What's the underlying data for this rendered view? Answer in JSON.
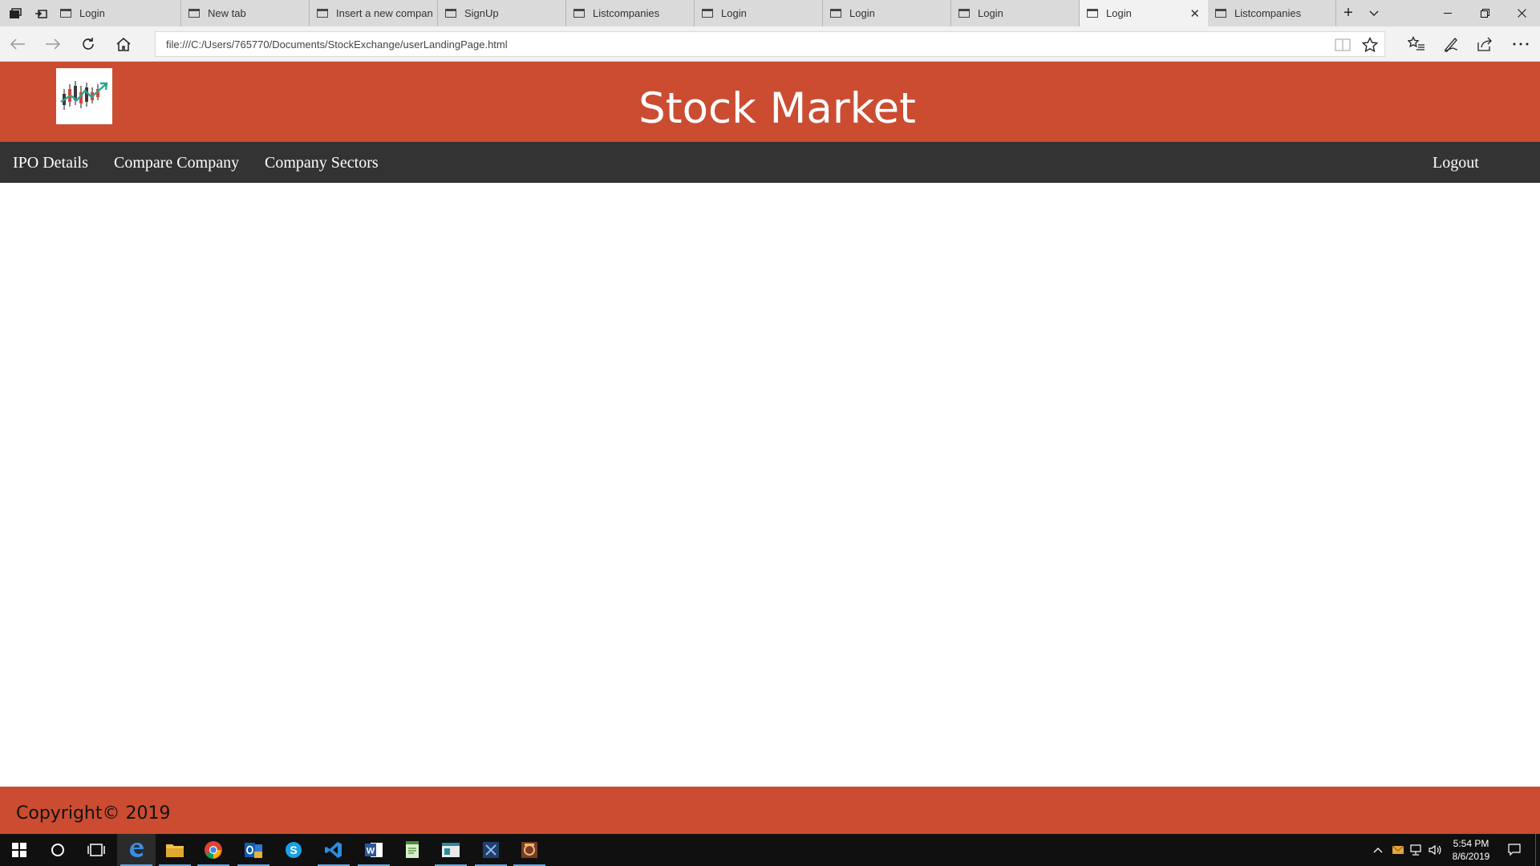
{
  "browser": {
    "tabs": [
      {
        "label": "Login"
      },
      {
        "label": "New tab"
      },
      {
        "label": "Insert a new compan"
      },
      {
        "label": "SignUp"
      },
      {
        "label": "Listcompanies"
      },
      {
        "label": "Login"
      },
      {
        "label": "Login"
      },
      {
        "label": "Login"
      },
      {
        "label": "Login",
        "active": true
      },
      {
        "label": "Listcompanies"
      }
    ],
    "url": "file:///C:/Users/765770/Documents/StockExchange/userLandingPage.html"
  },
  "page": {
    "title": "Stock Market",
    "nav": {
      "ipo": "IPO Details",
      "compare": "Compare Company",
      "sectors": "Company Sectors",
      "logout": "Logout"
    },
    "footer": "Copyright© 2019",
    "colors": {
      "brand": "#cb4c31",
      "nav": "#333333"
    }
  },
  "taskbar": {
    "apps": [
      "start",
      "cortana",
      "task-view",
      "edge",
      "file-explorer",
      "chrome",
      "outlook",
      "skype",
      "vscode",
      "word",
      "notepad",
      "app",
      "studio",
      "app2"
    ],
    "clock": {
      "time": "5:54 PM",
      "date": "8/6/2019"
    }
  }
}
